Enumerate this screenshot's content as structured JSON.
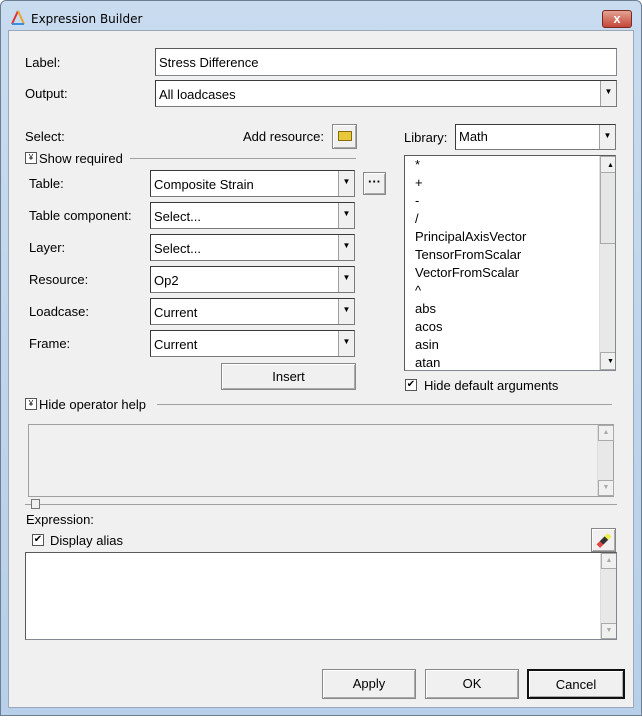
{
  "window": {
    "title": "Expression Builder",
    "close_label": "x"
  },
  "form": {
    "label_label": "Label:",
    "label_value": "Stress Difference",
    "output_label": "Output:",
    "output_value": "All loadcases"
  },
  "select": {
    "heading": "Select:",
    "add_resource_label": "Add resource:",
    "show_required": "Show required",
    "rows": [
      {
        "label": "Table:",
        "value": "Composite Strain"
      },
      {
        "label": "Table component:",
        "value": "Select..."
      },
      {
        "label": "Layer:",
        "value": "Select..."
      },
      {
        "label": "Resource:",
        "value": "Op2"
      },
      {
        "label": "Loadcase:",
        "value": "Current"
      },
      {
        "label": "Frame:",
        "value": "Current"
      }
    ],
    "more_button": "···",
    "insert_button": "Insert"
  },
  "library": {
    "label": "Library:",
    "value": "Math",
    "items": [
      "*",
      "+",
      "-",
      "/",
      "PrincipalAxisVector",
      "TensorFromScalar",
      "VectorFromScalar",
      "^",
      "abs",
      "acos",
      "asin",
      "atan"
    ],
    "hide_default_arguments": "Hide default arguments",
    "hide_default_checked": true
  },
  "help": {
    "toggle_label": "Hide operator help"
  },
  "expression": {
    "label": "Expression:",
    "display_alias": "Display alias",
    "display_alias_checked": true,
    "value": ""
  },
  "buttons": {
    "apply": "Apply",
    "ok": "OK",
    "cancel": "Cancel"
  }
}
